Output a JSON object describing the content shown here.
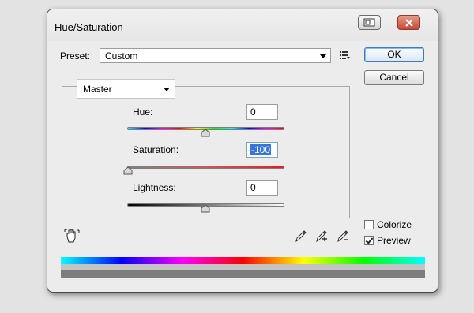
{
  "window": {
    "title": "Hue/Saturation"
  },
  "preset": {
    "label": "Preset:",
    "value": "Custom"
  },
  "buttons": {
    "ok": "OK",
    "cancel": "Cancel"
  },
  "channel": {
    "value": "Master"
  },
  "adjustments": {
    "hue": {
      "label": "Hue:",
      "value": "0",
      "min": -180,
      "max": 180
    },
    "saturation": {
      "label": "Saturation:",
      "value": "-100",
      "min": -100,
      "max": 100
    },
    "lightness": {
      "label": "Lightness:",
      "value": "0",
      "min": -100,
      "max": 100
    }
  },
  "options": {
    "colorize": {
      "label": "Colorize",
      "checked": false
    },
    "preview": {
      "label": "Preview",
      "checked": true
    }
  },
  "icons": [
    "restore-icon",
    "close-icon",
    "preset-menu-icon",
    "target-adjustment-hand-icon",
    "eyedropper-icon",
    "eyedropper-add-icon",
    "eyedropper-subtract-icon"
  ]
}
